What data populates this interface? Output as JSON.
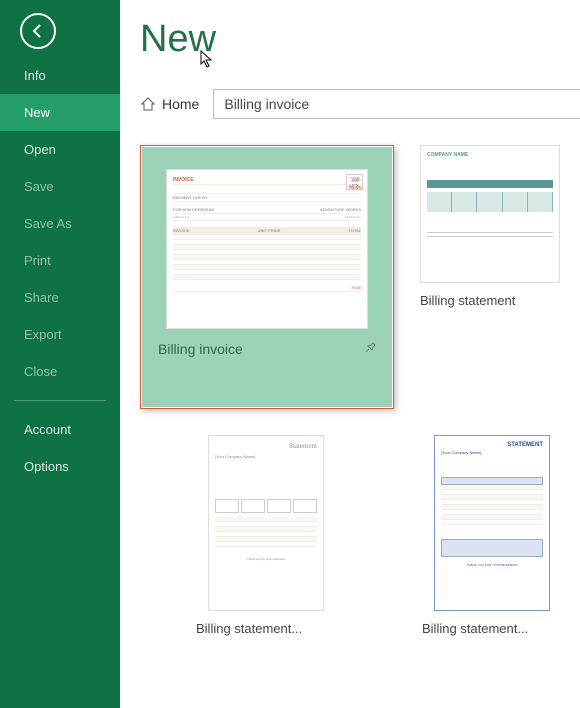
{
  "sidebar": {
    "items": [
      {
        "label": "Info",
        "state": "normal"
      },
      {
        "label": "New",
        "state": "active"
      },
      {
        "label": "Open",
        "state": "normal"
      },
      {
        "label": "Save",
        "state": "dim"
      },
      {
        "label": "Save As",
        "state": "dim"
      },
      {
        "label": "Print",
        "state": "dim"
      },
      {
        "label": "Share",
        "state": "dim"
      },
      {
        "label": "Export",
        "state": "dim"
      },
      {
        "label": "Close",
        "state": "dim"
      }
    ],
    "footer": [
      {
        "label": "Account"
      },
      {
        "label": "Options"
      }
    ]
  },
  "page": {
    "title": "New",
    "home_label": "Home",
    "search_value": "Billing invoice"
  },
  "templates": [
    {
      "label": "Billing invoice",
      "selected": true,
      "preview_amount": "79.65",
      "preview_word": "INVOICE",
      "preview_num": "0001"
    },
    {
      "label": "Billing statement",
      "selected": false,
      "preview_heading": "COMPANY NAME"
    },
    {
      "label": "Billing statement...",
      "selected": false,
      "preview_heading": "Statement"
    },
    {
      "label": "Billing statement...",
      "selected": false,
      "preview_heading": "STATEMENT"
    }
  ]
}
